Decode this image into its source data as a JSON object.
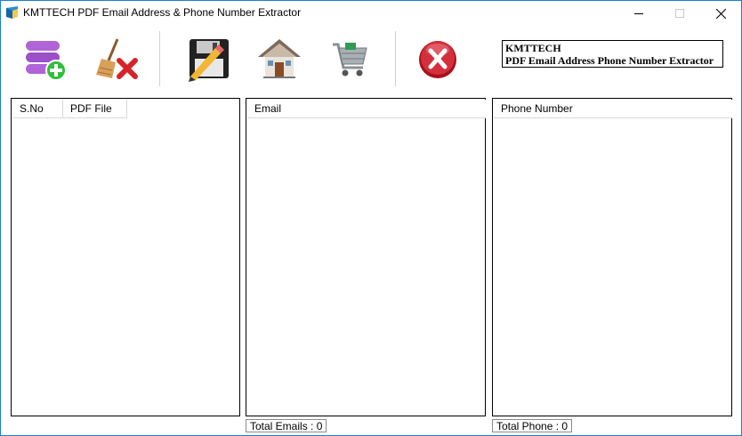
{
  "window": {
    "title": "KMTTECH PDF Email Address & Phone Number Extractor",
    "accent_color": "#1b7fd4"
  },
  "toolbar": {
    "buttons": [
      {
        "name": "add-pdf",
        "icon": "database-add-icon"
      },
      {
        "name": "clear",
        "icon": "broom-clear-icon"
      },
      {
        "name": "save",
        "icon": "floppy-save-icon"
      },
      {
        "name": "home",
        "icon": "house-icon"
      },
      {
        "name": "buy",
        "icon": "shopping-cart-icon"
      },
      {
        "name": "exit",
        "icon": "red-x-exit-icon"
      }
    ],
    "brand_line1": "KMTTECH",
    "brand_line2": "PDF Email Address Phone Number Extractor"
  },
  "pdf_panel": {
    "columns": [
      "S.No",
      "PDF File"
    ],
    "rows": []
  },
  "email_panel": {
    "columns": [
      "Email"
    ],
    "rows": []
  },
  "phone_panel": {
    "columns": [
      "Phone Number"
    ],
    "rows": []
  },
  "status": {
    "total_emails": "Total Emails : 0",
    "total_phone": "Total Phone : 0"
  }
}
